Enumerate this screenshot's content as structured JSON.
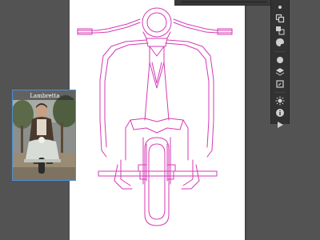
{
  "app": {
    "type": "vector-illustration-editor",
    "accent_color": "#4b8fd6",
    "canvas_background": "#535353",
    "artboard_color": "#ffffff",
    "path_stroke_color": "#d63ab4"
  },
  "artwork": {
    "subject": "vespa-scooter-front-view-outline"
  },
  "placed_image": {
    "masthead_text": "Lambretta",
    "selected": true
  },
  "tools_panel": {
    "icons": [
      "bullet-icon",
      "move-icon",
      "arrange-icon",
      "palette-icon",
      "circle-icon",
      "layers-icon",
      "artboard-icon",
      "sun-icon",
      "info-icon",
      "play-icon",
      "link-icon"
    ]
  }
}
